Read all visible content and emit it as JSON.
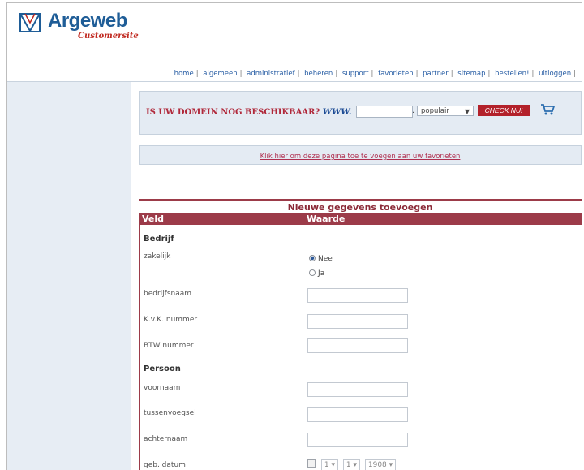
{
  "brand": {
    "name": "Argeweb",
    "subtitle": "Customersite"
  },
  "nav": [
    "home",
    "algemeen",
    "administratief",
    "beheren",
    "support",
    "favorieten",
    "partner",
    "sitemap",
    "bestellen!",
    "uitloggen"
  ],
  "domain": {
    "question": "IS UW DOMEIN NOG BESCHIKBAAR?",
    "www": "WWW.",
    "input_value": "",
    "dot": ".",
    "tld_selected": "populair",
    "check_label": "CHECK NU!"
  },
  "favorites_link": "Klik hier om deze pagina toe te voegen aan uw favorieten",
  "form": {
    "title": "Nieuwe gegevens toevoegen",
    "col_field": "Veld",
    "col_value": "Waarde",
    "section_company": "Bedrijf",
    "zakelijk": "zakelijk",
    "radio_no": "Nee",
    "radio_yes": "Ja",
    "bedrijfsnaam": "bedrijfsnaam",
    "kvk": "K.v.K. nummer",
    "btw": "BTW nummer",
    "section_person": "Persoon",
    "voornaam": "voornaam",
    "tussenvoegsel": "tussenvoegsel",
    "achternaam": "achternaam",
    "geb_datum": "geb. datum",
    "day": "1",
    "month": "1",
    "year": "1908"
  },
  "colors": {
    "brand_blue": "#1f5d97",
    "accent_red": "#9c3b49",
    "panel": "#e4ebf3"
  },
  "icons": [
    "logo-icon",
    "cart-icon",
    "dropdown-arrow-icon"
  ]
}
